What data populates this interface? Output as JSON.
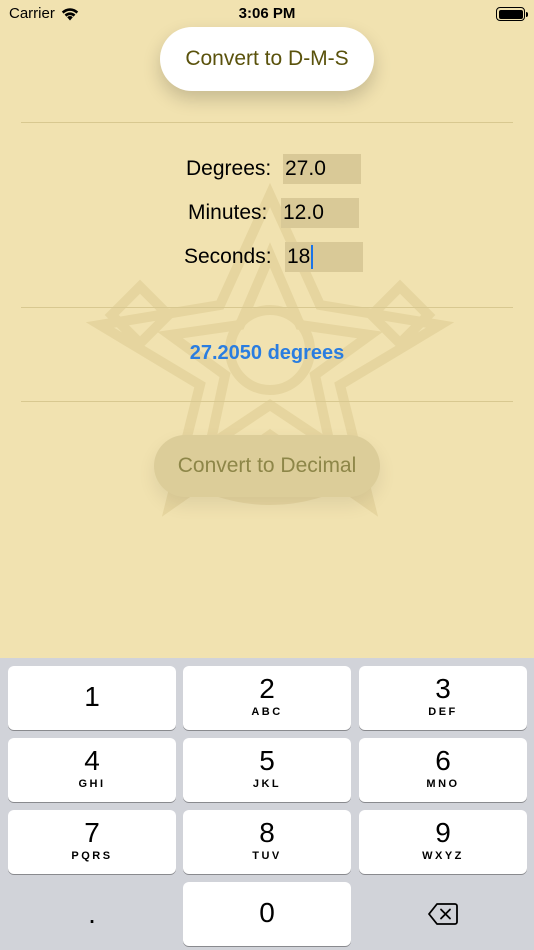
{
  "status_bar": {
    "carrier": "Carrier",
    "time": "3:06 PM"
  },
  "buttons": {
    "dms_label": "Convert to D-M-S",
    "decimal_label": "Convert to Decimal"
  },
  "fields": {
    "degrees": {
      "label": "Degrees:",
      "value": "27.0"
    },
    "minutes": {
      "label": "Minutes:",
      "value": "12.0"
    },
    "seconds": {
      "label": "Seconds:",
      "value": "18"
    }
  },
  "result": "27.2050 degrees",
  "keypad": {
    "keys": [
      {
        "digit": "1",
        "letters": ""
      },
      {
        "digit": "2",
        "letters": "ABC"
      },
      {
        "digit": "3",
        "letters": "DEF"
      },
      {
        "digit": "4",
        "letters": "GHI"
      },
      {
        "digit": "5",
        "letters": "JKL"
      },
      {
        "digit": "6",
        "letters": "MNO"
      },
      {
        "digit": "7",
        "letters": "PQRS"
      },
      {
        "digit": "8",
        "letters": "TUV"
      },
      {
        "digit": "9",
        "letters": "WXYZ"
      }
    ],
    "decimal": ".",
    "zero": "0",
    "delete_icon": "delete-backspace-icon"
  },
  "colors": {
    "background": "#f1e2b0",
    "accent": "#2a7de0",
    "button_text": "#5a520c"
  }
}
